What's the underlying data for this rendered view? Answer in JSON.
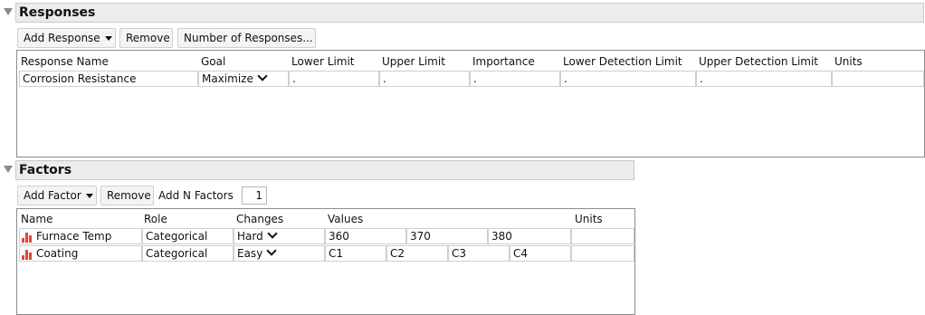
{
  "responses": {
    "title": "Responses",
    "add_label": "Add Response",
    "remove_label": "Remove",
    "number_label": "Number of Responses...",
    "columns": [
      "Response Name",
      "Goal",
      "Lower Limit",
      "Upper Limit",
      "Importance",
      "Lower Detection Limit",
      "Upper Detection Limit",
      "Units"
    ],
    "rows": [
      {
        "name": "Corrosion Resistance",
        "goal": "Maximize",
        "lower": ".",
        "upper": ".",
        "importance": ".",
        "lower_detect": ".",
        "upper_detect": ".",
        "units": ""
      }
    ]
  },
  "factors": {
    "title": "Factors",
    "add_label": "Add Factor",
    "remove_label": "Remove",
    "add_n_label": "Add N Factors",
    "n_value": "1",
    "columns": [
      "Name",
      "Role",
      "Changes",
      "Values",
      "Units"
    ],
    "rows": [
      {
        "name": "Furnace Temp",
        "role": "Categorical",
        "changes": "Hard",
        "values": [
          "360",
          "370",
          "380"
        ],
        "units": ""
      },
      {
        "name": "Coating",
        "role": "Categorical",
        "changes": "Easy",
        "values": [
          "C1",
          "C2",
          "C3",
          "C4"
        ],
        "units": ""
      }
    ]
  },
  "icons": {
    "categorical_factor": "red-bar-chart-icon",
    "outline_toggle": "disclosure-triangle-icon"
  },
  "colors": {
    "factor_icon": "#e0463a",
    "header_bg": "#ececec"
  }
}
